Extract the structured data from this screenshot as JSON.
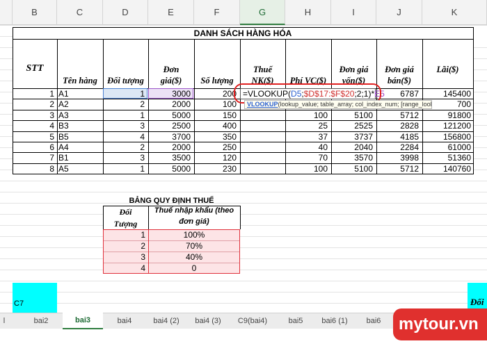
{
  "columns": [
    "B",
    "C",
    "D",
    "E",
    "F",
    "G",
    "H",
    "I",
    "J",
    "K"
  ],
  "table_title": "DANH SÁCH HÀNG HÓA",
  "headers": {
    "stt": "STT",
    "ten_hang": "Tên hàng",
    "doi_tuong": "Đối tượng",
    "don_gia_1": "Đơn",
    "don_gia_2": "giá($)",
    "so_luong": "Số lượng",
    "thue_1": "Thuế",
    "thue_2": "NK($)",
    "phi_vc": "Phí VC($)",
    "don_gia_von_1": "Đơn giá",
    "don_gia_von_2": "vốn($)",
    "don_gia_ban_1": "Đơn giá",
    "don_gia_ban_2": "bán($)",
    "lai": "Lãi($)"
  },
  "rows": [
    {
      "stt": "1",
      "ten": "A1",
      "doi_tuong": "1",
      "don_gia": "3000",
      "so_luong": "200",
      "phi_vc": "",
      "gia_von": "",
      "gia_ban": "6787",
      "lai": "145400"
    },
    {
      "stt": "2",
      "ten": "A2",
      "doi_tuong": "2",
      "don_gia": "2000",
      "so_luong": "100",
      "phi_vc": "",
      "gia_von": "",
      "gia_ban": "",
      "lai": "700"
    },
    {
      "stt": "3",
      "ten": "A3",
      "doi_tuong": "1",
      "don_gia": "5000",
      "so_luong": "150",
      "phi_vc": "100",
      "gia_von": "5100",
      "gia_ban": "5712",
      "lai": "91800"
    },
    {
      "stt": "4",
      "ten": "B3",
      "doi_tuong": "3",
      "don_gia": "2500",
      "so_luong": "400",
      "phi_vc": "25",
      "gia_von": "2525",
      "gia_ban": "2828",
      "lai": "121200"
    },
    {
      "stt": "5",
      "ten": "B5",
      "doi_tuong": "4",
      "don_gia": "3700",
      "so_luong": "350",
      "phi_vc": "37",
      "gia_von": "3737",
      "gia_ban": "4185",
      "lai": "156800"
    },
    {
      "stt": "6",
      "ten": "A4",
      "doi_tuong": "2",
      "don_gia": "2000",
      "so_luong": "250",
      "phi_vc": "40",
      "gia_von": "2040",
      "gia_ban": "2284",
      "lai": "61000"
    },
    {
      "stt": "7",
      "ten": "B1",
      "doi_tuong": "3",
      "don_gia": "3500",
      "so_luong": "120",
      "phi_vc": "70",
      "gia_von": "3570",
      "gia_ban": "3998",
      "lai": "51360"
    },
    {
      "stt": "8",
      "ten": "A5",
      "doi_tuong": "1",
      "don_gia": "5000",
      "so_luong": "230",
      "phi_vc": "100",
      "gia_von": "5100",
      "gia_ban": "5712",
      "lai": "140760"
    }
  ],
  "formula": {
    "prefix": "=VLOOKUP(",
    "arg1": "D5",
    "sep1": ";",
    "arg2": "$D$17:$F$20",
    "rest": ";2;1)*",
    "arg3": "E5"
  },
  "tooltip": {
    "fn": "VLOOKUP",
    "args": "(lookup_value; table_array; col_index_num; [range_lookup])"
  },
  "rule_table": {
    "title": "BẢNG QUY ĐỊNH THUẾ",
    "h1_a": "Đối",
    "h1_b": "Tượng",
    "h2_a": "Thuế nhập khẩu (theo",
    "h2_b": "đơn giá)",
    "rows": [
      {
        "k": "1",
        "v": "100%"
      },
      {
        "k": "2",
        "v": "70%"
      },
      {
        "k": "3",
        "v": "40%"
      },
      {
        "k": "4",
        "v": "0"
      }
    ]
  },
  "cell_c7": "C7",
  "cell_right": "Đối",
  "tabs": [
    "bai2",
    "bai3",
    "bai4",
    "bai4 (2)",
    "bai4 (3)",
    "C9(bai4)",
    "bai5",
    "bai6 (1)",
    "bai6"
  ],
  "active_tab": "bai3",
  "watermark": "mytour.vn",
  "colors": {
    "accent": "#2f7d3f",
    "formula_ring": "#e02020",
    "cyan": "#00ffff",
    "watermark_bg": "#e0302e"
  }
}
